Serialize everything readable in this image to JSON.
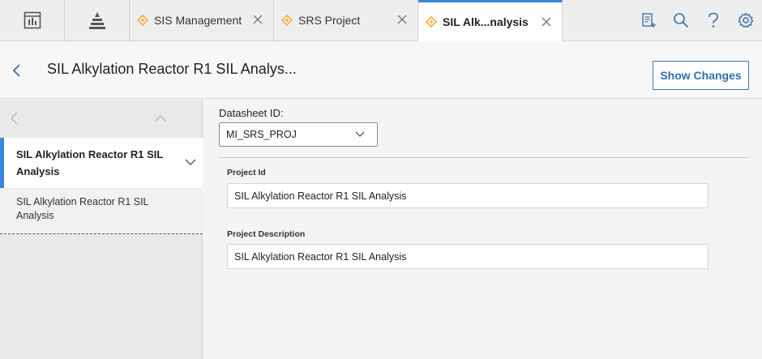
{
  "tabs": [
    {
      "label": "SIS Management",
      "active": false
    },
    {
      "label": "SRS Project",
      "active": false
    },
    {
      "label": "SIL Alk...nalysis",
      "active": true
    }
  ],
  "toolbar_icons": [
    "report-icon",
    "search-icon",
    "help-icon",
    "settings-icon"
  ],
  "header": {
    "title": "SIL Alkylation Reactor R1 SIL Analys...",
    "show_changes_label": "Show Changes"
  },
  "sidebar": {
    "active_item": "SIL Alkylation Reactor R1 SIL Analysis",
    "sub_item": "SIL Alkylation Reactor R1 SIL Analysis"
  },
  "datasheet": {
    "label": "Datasheet ID:",
    "value": "MI_SRS_PROJ"
  },
  "fields": {
    "project_id": {
      "label": "Project Id",
      "value": "SIL Alkylation Reactor R1 SIL Analysis"
    },
    "project_description": {
      "label": "Project Description",
      "value": "SIL Alkylation Reactor R1 SIL Analysis"
    }
  },
  "colors": {
    "accent": "#3a86d8",
    "tab_icon": "#f2b233",
    "button_border": "#3a78b8"
  }
}
